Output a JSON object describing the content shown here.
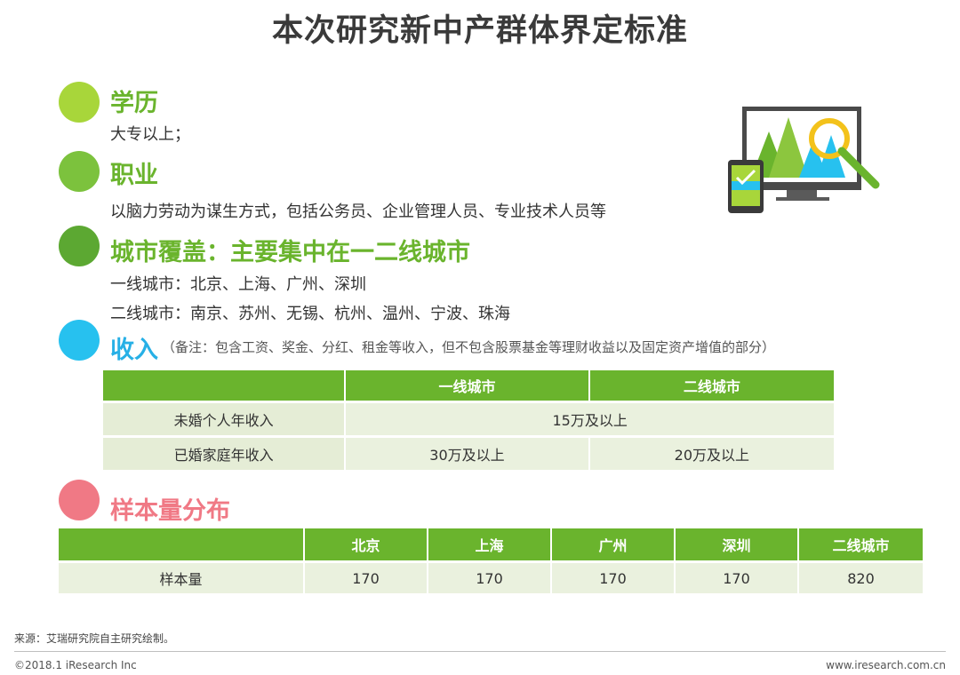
{
  "title": "本次研究新中产群体界定标准",
  "sections": {
    "education": {
      "title": "学历",
      "text": "大专以上；"
    },
    "occupation": {
      "title": "职业",
      "text": "以脑力劳动为谋生方式，包括公务员、企业管理人员、专业技术人员等"
    },
    "city": {
      "title": "城市覆盖：主要集中在一二线城市",
      "line1": "一线城市：北京、上海、广州、深圳",
      "line2": "二线城市：南京、苏州、无锡、杭州、温州、宁波、珠海"
    },
    "income": {
      "title": "收入",
      "note": "（备注：包含工资、奖金、分红、租金等收入，但不包含股票基金等理财收益以及固定资产增值的部分）"
    },
    "sample": {
      "title": "样本量分布"
    }
  },
  "income_table": {
    "headers": [
      "",
      "一线城市",
      "二线城市"
    ],
    "rows": [
      {
        "label": "未婚个人年收入",
        "merged": "15万及以上"
      },
      {
        "label": "已婚家庭年收入",
        "tier1": "30万及以上",
        "tier2": "20万及以上"
      }
    ]
  },
  "sample_table": {
    "headers": [
      "",
      "北京",
      "上海",
      "广州",
      "深圳",
      "二线城市"
    ],
    "row": {
      "label": "样本量",
      "values": [
        "170",
        "170",
        "170",
        "170",
        "820"
      ]
    }
  },
  "footer": {
    "source": "来源：艾瑞研究院自主研究绘制。",
    "copyright": "©2018.1 iResearch Inc",
    "url": "www.iresearch.com.cn"
  },
  "colors": {
    "green": "#6ab42d",
    "lime": "#a8d63a",
    "mid_green": "#5ca832",
    "dark_green": "#4a8f2a",
    "blue": "#27c1ef",
    "pink": "#f07985",
    "cell_bg": "#eaf1de"
  },
  "icons": [
    "monitor-icon",
    "magnifier-icon",
    "tablet-icon"
  ]
}
